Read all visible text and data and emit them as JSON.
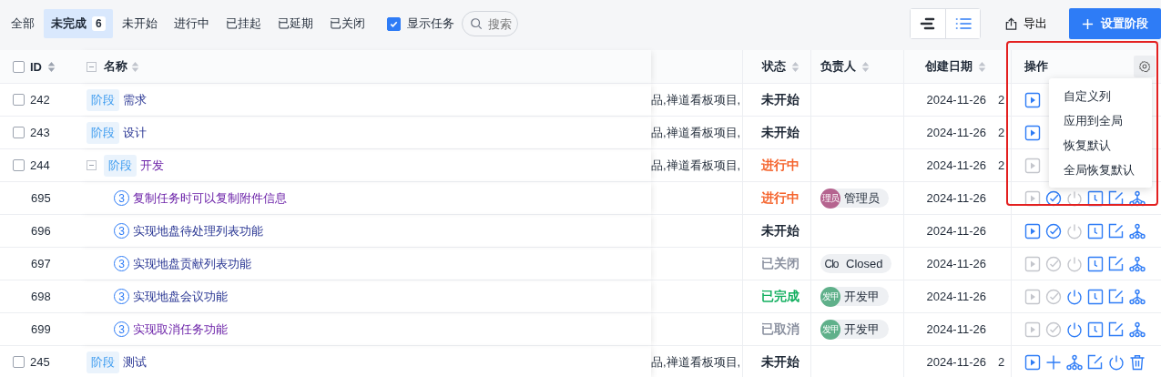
{
  "tabs": [
    {
      "label": "全部",
      "selected": false
    },
    {
      "label": "未完成",
      "count": "6",
      "selected": true
    },
    {
      "label": "未开始",
      "selected": false
    },
    {
      "label": "进行中",
      "selected": false
    },
    {
      "label": "已挂起",
      "selected": false
    },
    {
      "label": "已延期",
      "selected": false
    },
    {
      "label": "已关闭",
      "selected": false
    }
  ],
  "show_tasks": {
    "label": "显示任务",
    "checked": true
  },
  "search": {
    "placeholder": "搜索"
  },
  "view_toggle": [
    {
      "kind": "gantt",
      "selected": false
    },
    {
      "kind": "list",
      "selected": true
    }
  ],
  "export_button": "导出",
  "primary_button": "设置阶段",
  "select_all": {
    "checked": false
  },
  "columns": {
    "id": "ID",
    "name": "名称",
    "status": "状态",
    "owner": "负责人",
    "created": "创建日期",
    "actions": "操作"
  },
  "rows": [
    {
      "id": "242",
      "checked": false,
      "tag": "阶段",
      "name": "需求",
      "visited": false,
      "products": "品,禅道看板项目,",
      "status": {
        "label": "未开始",
        "color": "#1f2937"
      },
      "created": "2024-11-26",
      "column_8": "2",
      "actions": [
        {
          "kind": "play",
          "disabled": false
        }
      ]
    },
    {
      "id": "243",
      "checked": false,
      "tag": "阶段",
      "name": "设计",
      "visited": false,
      "products": "品,禅道看板项目,",
      "status": {
        "label": "未开始",
        "color": "#1f2937"
      },
      "created": "2024-11-26",
      "column_8": "2",
      "actions": [
        {
          "kind": "play",
          "disabled": false
        }
      ]
    },
    {
      "id": "244",
      "checked": false,
      "tag": "阶段",
      "name": "开发",
      "visited": true,
      "expanded": true,
      "products": "品,禅道看板项目,",
      "status": {
        "label": "进行中",
        "color": "#f5642d"
      },
      "created": "2024-11-26",
      "column_8": "2",
      "actions": [
        {
          "kind": "play",
          "disabled": true
        }
      ],
      "children": [
        {
          "id": "695",
          "priority": "3",
          "name": "复制任务时可以复制附件信息",
          "visited": true,
          "status": {
            "label": "进行中",
            "color": "#f5642d"
          },
          "owner": {
            "avatar": "理员",
            "color": "#b5648f",
            "name": "管理员"
          },
          "created": "2024-11-26",
          "actions": [
            {
              "kind": "play",
              "disabled": true
            },
            {
              "kind": "check",
              "disabled": false
            },
            {
              "kind": "power",
              "disabled": true
            },
            {
              "kind": "clock",
              "disabled": false
            },
            {
              "kind": "edit",
              "disabled": false
            },
            {
              "kind": "tree",
              "disabled": false
            }
          ]
        },
        {
          "id": "696",
          "priority": "3",
          "name": "实现地盘待处理列表功能",
          "visited": false,
          "status": {
            "label": "未开始",
            "color": "#1f2937"
          },
          "created": "2024-11-26",
          "actions": [
            {
              "kind": "play",
              "disabled": false
            },
            {
              "kind": "check",
              "disabled": false
            },
            {
              "kind": "power",
              "disabled": true
            },
            {
              "kind": "clock",
              "disabled": false
            },
            {
              "kind": "edit",
              "disabled": false
            },
            {
              "kind": "tree",
              "disabled": false
            }
          ]
        },
        {
          "id": "697",
          "priority": "3",
          "name": "实现地盘贡献列表功能",
          "visited": false,
          "status": {
            "label": "已关闭",
            "color": "#8b91a0"
          },
          "owner": {
            "avatar": "Clo",
            "name": "Closed"
          },
          "created": "2024-11-26",
          "actions": [
            {
              "kind": "play",
              "disabled": true
            },
            {
              "kind": "check",
              "disabled": true
            },
            {
              "kind": "power",
              "disabled": true
            },
            {
              "kind": "clock",
              "disabled": false
            },
            {
              "kind": "edit",
              "disabled": false
            },
            {
              "kind": "tree",
              "disabled": false
            }
          ]
        },
        {
          "id": "698",
          "priority": "3",
          "name": "实现地盘会议功能",
          "visited": false,
          "status": {
            "label": "已完成",
            "color": "#16b062"
          },
          "owner": {
            "avatar": "发甲",
            "color": "#5fb08a",
            "name": "开发甲"
          },
          "created": "2024-11-26",
          "actions": [
            {
              "kind": "play",
              "disabled": true
            },
            {
              "kind": "check",
              "disabled": true
            },
            {
              "kind": "power",
              "disabled": false
            },
            {
              "kind": "clock",
              "disabled": false
            },
            {
              "kind": "edit",
              "disabled": false
            },
            {
              "kind": "tree",
              "disabled": false
            }
          ]
        },
        {
          "id": "699",
          "priority": "3",
          "name": "实现取消任务功能",
          "visited": true,
          "status": {
            "label": "已取消",
            "color": "#8b91a0"
          },
          "owner": {
            "avatar": "发甲",
            "color": "#5fb08a",
            "name": "开发甲"
          },
          "created": "2024-11-26",
          "actions": [
            {
              "kind": "play",
              "disabled": true
            },
            {
              "kind": "check",
              "disabled": true
            },
            {
              "kind": "power",
              "disabled": false
            },
            {
              "kind": "clock",
              "disabled": false
            },
            {
              "kind": "edit",
              "disabled": false
            },
            {
              "kind": "tree",
              "disabled": false
            }
          ]
        }
      ]
    },
    {
      "id": "245",
      "checked": false,
      "tag": "阶段",
      "name": "测试",
      "visited": false,
      "products": "品,禅道看板项目,",
      "status": {
        "label": "未开始",
        "color": "#1f2937"
      },
      "created": "2024-11-26",
      "column_8": "2",
      "actions": [
        {
          "kind": "play",
          "disabled": false
        },
        {
          "kind": "plus",
          "disabled": false
        },
        {
          "kind": "tree",
          "disabled": false
        },
        {
          "kind": "edit",
          "disabled": false
        },
        {
          "kind": "power",
          "disabled": false
        },
        {
          "kind": "trash",
          "disabled": false
        }
      ]
    }
  ],
  "column_menu": [
    "自定义列",
    "应用到全局",
    "恢复默认",
    "全局恢复默认"
  ],
  "highlight": {
    "shown": true
  }
}
